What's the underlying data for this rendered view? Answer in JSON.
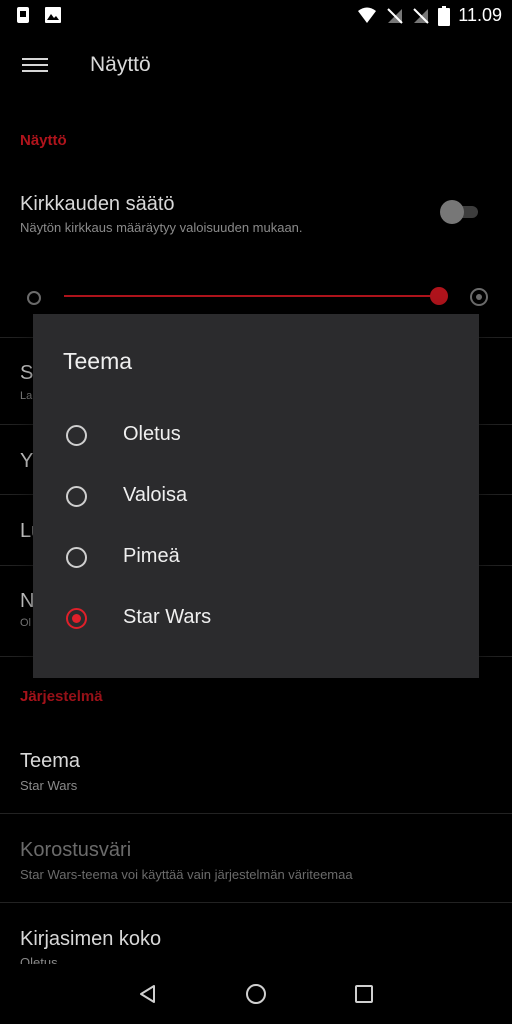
{
  "status": {
    "time": "11.09"
  },
  "appbar": {
    "title": "Näyttö"
  },
  "sections": {
    "display_header": "Näyttö",
    "system_header": "Järjestelmä"
  },
  "brightness": {
    "title": "Kirkkauden säätö",
    "subtitle": "Näytön kirkkaus määräytyy valoisuuden mukaan.",
    "auto_enabled": false,
    "level_fraction": 0.95
  },
  "behind_fragments": [
    "S",
    "La",
    "Y",
    "Lu",
    "N",
    "Ol"
  ],
  "theme_item": {
    "title": "Teema",
    "subtitle": "Star Wars"
  },
  "accent_item": {
    "title": "Korostusväri",
    "subtitle": "Star Wars-teema voi käyttää vain järjestelmän väriteemaa"
  },
  "font_item": {
    "title": "Kirjasimen koko",
    "subtitle": "Oletus"
  },
  "dialog": {
    "title": "Teema",
    "options": [
      "Oletus",
      "Valoisa",
      "Pimeä",
      "Star Wars"
    ],
    "selected": "Star Wars"
  },
  "colors": {
    "accent": "#b0141c",
    "radio_selected": "#e0202a",
    "dialog_bg": "#2b2b2d"
  }
}
